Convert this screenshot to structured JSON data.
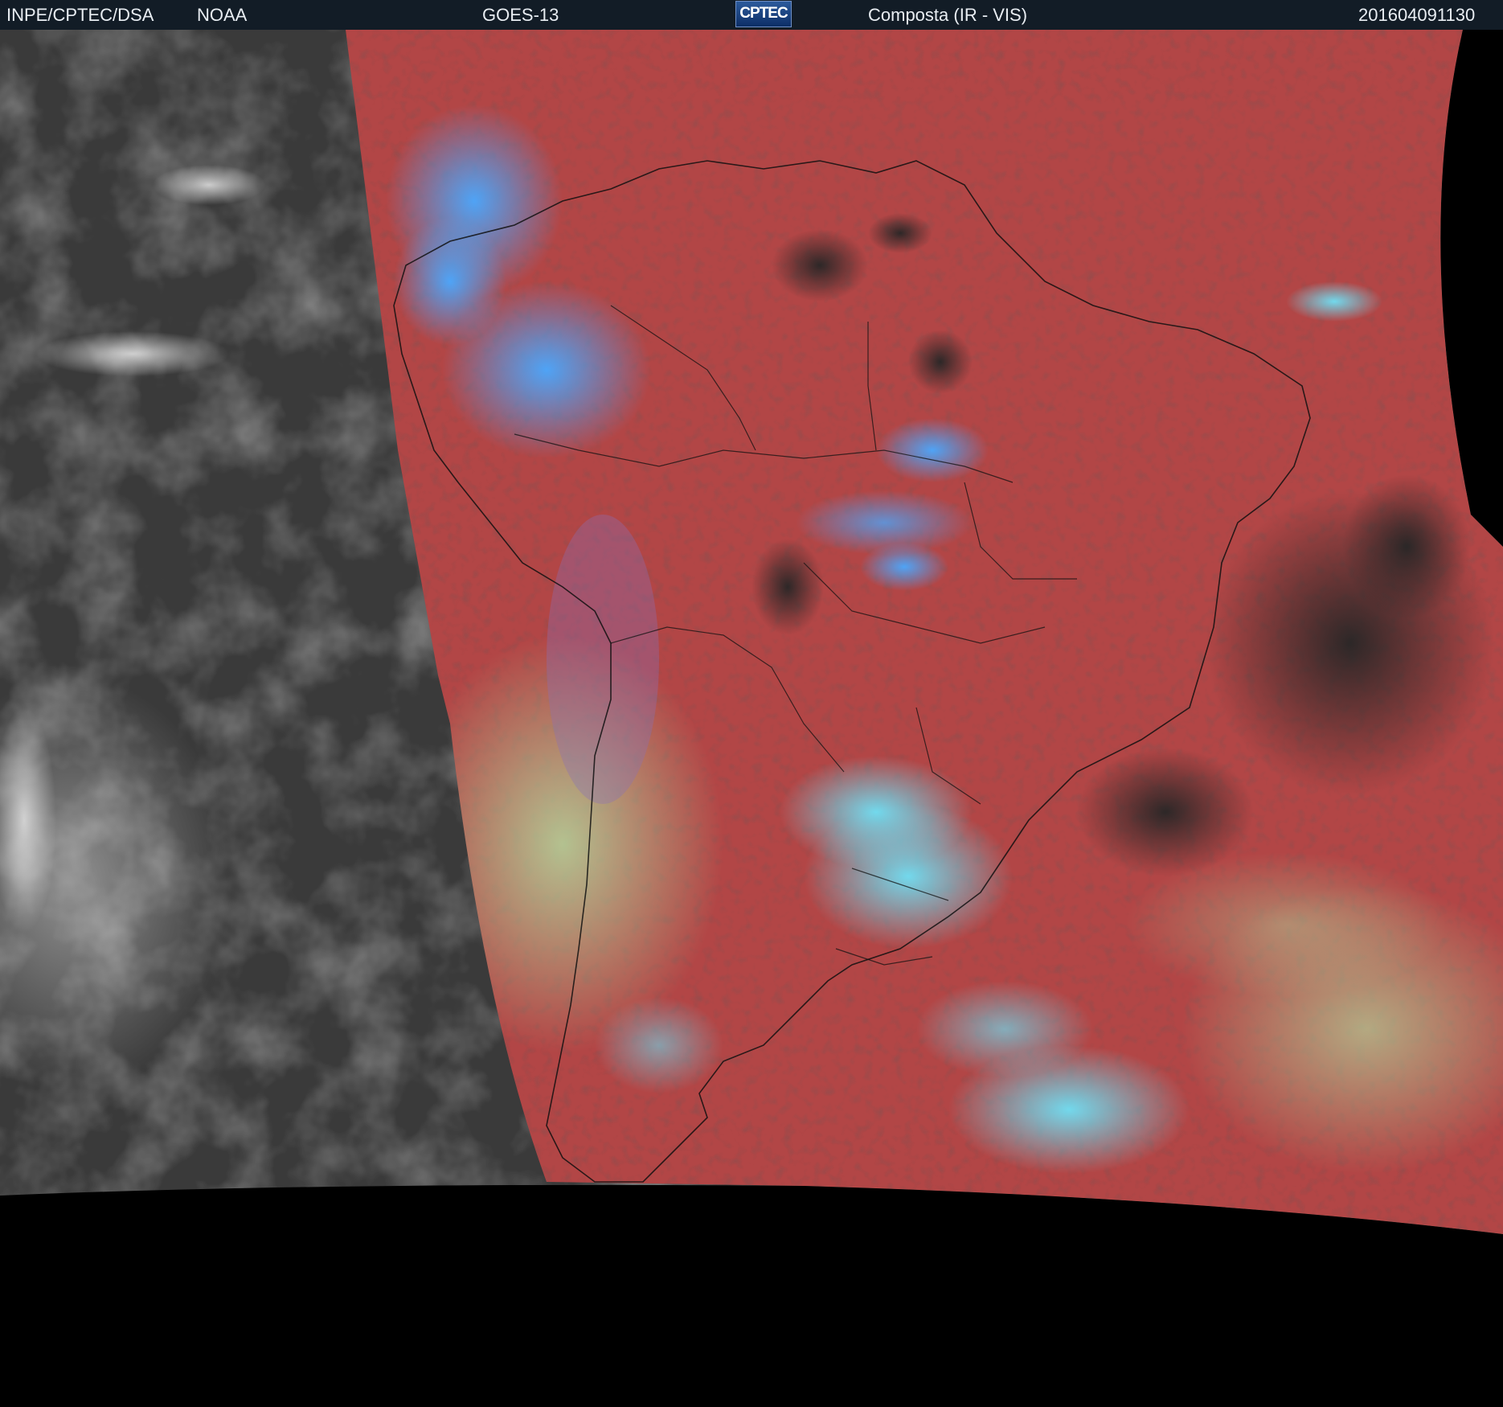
{
  "header": {
    "agency": "INPE/CPTEC/DSA",
    "partner": "NOAA",
    "satellite": "GOES-13",
    "logo_text": "CPTEC",
    "product": "Composta (IR - VIS)",
    "timestamp": "201604091130"
  },
  "colors": {
    "header_bg": "#121c26",
    "ocean_gray": "#3a3a3a",
    "composite_red": "#b24646",
    "cloud_blue": "#3fa0ff",
    "cloud_cyan": "#5fd6ee",
    "cloud_green": "#a6c890",
    "clear_dark": "#2a2a2a",
    "background": "#000000"
  }
}
